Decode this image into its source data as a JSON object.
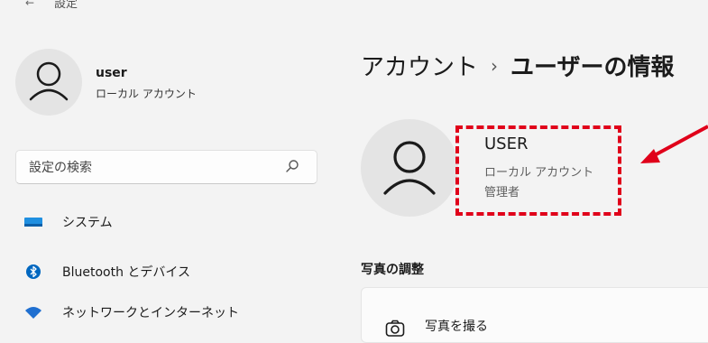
{
  "window": {
    "title": "設定"
  },
  "sidebar": {
    "user": {
      "name": "user",
      "account_type": "ローカル アカウント"
    },
    "search": {
      "placeholder": "設定の検索"
    },
    "nav_items": [
      {
        "label": "システム",
        "icon": "system-display-icon"
      },
      {
        "label": "Bluetooth とデバイス",
        "icon": "bluetooth-icon"
      },
      {
        "label": "ネットワークとインターネット",
        "icon": "wifi-icon"
      }
    ]
  },
  "main": {
    "breadcrumb": {
      "parent": "アカウント",
      "separator": "›",
      "current": "ユーザーの情報"
    },
    "profile": {
      "name": "USER",
      "account_type": "ローカル アカウント",
      "role": "管理者"
    },
    "photo_section": {
      "heading": "写真の調整",
      "take_photo_label": "写真を撮る"
    }
  },
  "annotation": {
    "color": "#e0001a"
  },
  "colors": {
    "accent": "#0067c0",
    "background": "#f3f3f3"
  }
}
